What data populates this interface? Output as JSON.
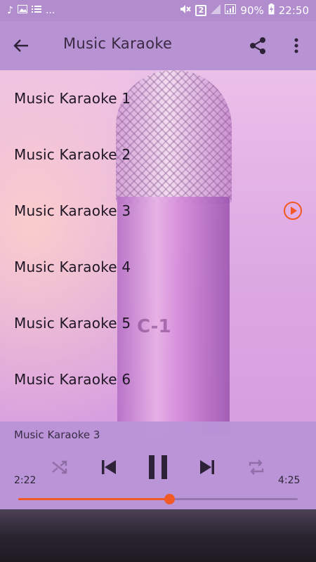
{
  "status_bar": {
    "battery": "90%",
    "time": "22:50",
    "notification_count": "2",
    "overflow": "..."
  },
  "app_bar": {
    "title": "Music Karaoke"
  },
  "songs": [
    {
      "label": "Music Karaoke 1",
      "playing": false
    },
    {
      "label": "Music Karaoke 2",
      "playing": false
    },
    {
      "label": "Music Karaoke 3",
      "playing": true
    },
    {
      "label": "Music Karaoke 4",
      "playing": false
    },
    {
      "label": "Music Karaoke 5",
      "playing": false
    },
    {
      "label": "Music Karaoke 6",
      "playing": false
    }
  ],
  "player": {
    "now_playing": "Music Karaoke 3",
    "elapsed": "2:22",
    "duration": "4:25",
    "progress": 0.54
  },
  "background": {
    "mic_label": "C-1"
  },
  "colors": {
    "accent": "#f15a24",
    "app_bar": "#b893d3",
    "player_panel": "#b894d6"
  }
}
